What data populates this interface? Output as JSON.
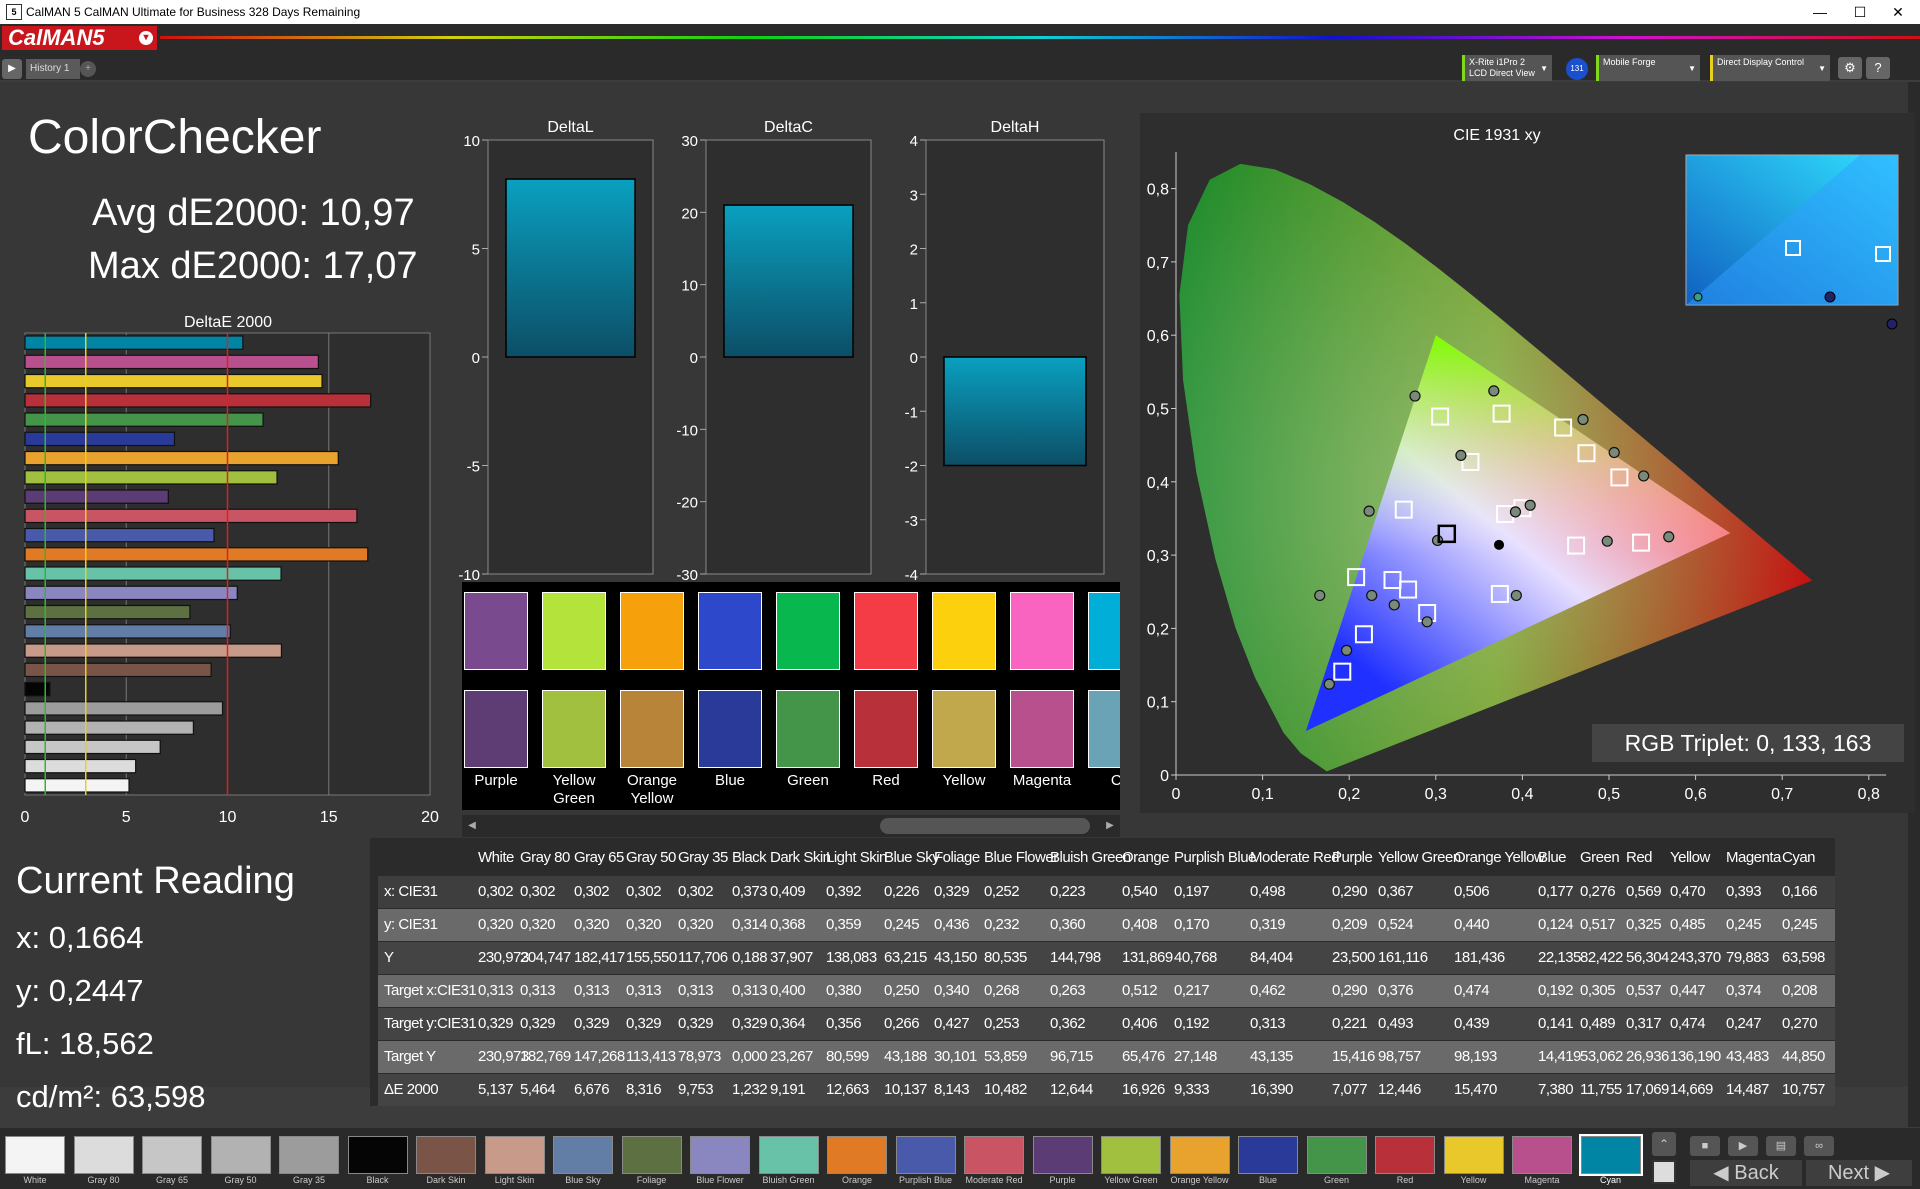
{
  "window": {
    "title": "CalMAN 5 CalMAN Ultimate for Business 328 Days Remaining",
    "minimize": "—",
    "maximize": "☐",
    "close": "✕"
  },
  "app": {
    "logo": "CalMAN5",
    "logo_dd": "▾",
    "history_tab": "History 1",
    "history_add": "+",
    "play": "▶"
  },
  "devices": [
    {
      "line1": "X-Rite i1Pro 2",
      "line2": "LCD Direct View",
      "badge": "131"
    },
    {
      "line1": "Mobile Forge",
      "line2": ""
    },
    {
      "line1": "Direct Display Control",
      "line2": ""
    }
  ],
  "toolbar_icons": [
    "gear-icon",
    "help-icon"
  ],
  "toolbar_glyphs": {
    "gear": "⚙",
    "help": "?"
  },
  "page": {
    "title": "ColorChecker",
    "avg": "Avg dE2000: 10,97",
    "max": "Max dE2000: 17,07"
  },
  "current_reading": {
    "title": "Current Reading",
    "x": "x: 0,1664",
    "y": "y: 0,2447",
    "fl": "fL: 18,562",
    "cdm2": "cd/m²: 63,598"
  },
  "rgb_triplet": "RGB Triplet: 0, 133, 163",
  "colors": {
    "White": "#f4f4f4",
    "Gray 80": "#dcdcdc",
    "Gray 65": "#c6c6c6",
    "Gray 50": "#b2b2b2",
    "Gray 35": "#9c9c9c",
    "Black": "#050505",
    "Dark Skin": "#7a5446",
    "Light Skin": "#c79a8a",
    "Blue Sky": "#627ea6",
    "Foliage": "#5c7042",
    "Blue Flower": "#8a86c0",
    "Bluish Green": "#68c2a8",
    "Orange": "#e07a24",
    "Purplish Blue": "#4a5aaa",
    "Moderate Red": "#c85464",
    "Purple": "#5c3c74",
    "Yellow Green": "#a2c040",
    "Orange Yellow": "#e8a22e",
    "Blue": "#2a3a98",
    "Green": "#44944a",
    "Red": "#b8303a",
    "Yellow": "#e8c82a",
    "Magenta": "#b8508e",
    "Cyan": "#0086a4"
  },
  "chart_data": [
    {
      "type": "bar",
      "title": "DeltaE 2000",
      "orientation": "horizontal",
      "categories": [
        "Cyan",
        "Magenta",
        "Yellow",
        "Red",
        "Green",
        "Blue",
        "Orange Yellow",
        "Yellow Green",
        "Purple",
        "Moderate Red",
        "Purplish Blue",
        "Orange",
        "Bluish Green",
        "Blue Flower",
        "Foliage",
        "Blue Sky",
        "Light Skin",
        "Dark Skin",
        "Black",
        "Gray 35",
        "Gray 50",
        "Gray 65",
        "Gray 80",
        "White"
      ],
      "values": [
        10.757,
        14.487,
        14.669,
        17.069,
        11.755,
        7.38,
        15.47,
        12.446,
        7.077,
        16.39,
        9.333,
        16.926,
        12.644,
        10.482,
        8.143,
        10.137,
        12.663,
        9.191,
        1.232,
        9.753,
        8.316,
        6.676,
        5.464,
        5.137
      ],
      "xlim": [
        0,
        20
      ],
      "xticks": [
        0,
        5,
        10,
        15,
        20
      ],
      "reference_lines": [
        1,
        3,
        10
      ]
    },
    {
      "type": "bar",
      "title": "DeltaL",
      "values": [
        8.2
      ],
      "ylim": [
        -10,
        10
      ],
      "yticks": [
        10,
        5,
        0,
        -5,
        -10
      ]
    },
    {
      "type": "bar",
      "title": "DeltaC",
      "values": [
        21.0
      ],
      "ylim": [
        -30,
        30
      ],
      "yticks": [
        30,
        20,
        10,
        0,
        -10,
        -20,
        -30
      ]
    },
    {
      "type": "bar",
      "title": "DeltaH",
      "values": [
        -2.0
      ],
      "ylim": [
        -4,
        4
      ],
      "yticks": [
        4,
        3,
        2,
        1,
        0,
        -1,
        -2,
        -3,
        -4
      ]
    },
    {
      "type": "scatter",
      "title": "CIE 1931 xy",
      "xlim": [
        0,
        0.8
      ],
      "ylim": [
        0,
        0.85
      ],
      "xticks": [
        "0",
        "0,1",
        "0,2",
        "0,3",
        "0,4",
        "0,5",
        "0,6",
        "0,7",
        "0,8"
      ],
      "yticks": [
        "0",
        "0,1",
        "0,2",
        "0,3",
        "0,4",
        "0,5",
        "0,6",
        "0,7",
        "0,8"
      ],
      "gamut": [
        [
          0.64,
          0.33
        ],
        [
          0.3,
          0.6
        ],
        [
          0.15,
          0.06
        ]
      ],
      "targets": [
        [
          0.313,
          0.329
        ],
        [
          0.4,
          0.364
        ],
        [
          0.38,
          0.356
        ],
        [
          0.25,
          0.266
        ],
        [
          0.34,
          0.427
        ],
        [
          0.268,
          0.253
        ],
        [
          0.263,
          0.362
        ],
        [
          0.512,
          0.406
        ],
        [
          0.217,
          0.192
        ],
        [
          0.462,
          0.313
        ],
        [
          0.29,
          0.221
        ],
        [
          0.376,
          0.493
        ],
        [
          0.474,
          0.439
        ],
        [
          0.192,
          0.141
        ],
        [
          0.305,
          0.489
        ],
        [
          0.537,
          0.317
        ],
        [
          0.447,
          0.474
        ],
        [
          0.374,
          0.247
        ],
        [
          0.208,
          0.27
        ]
      ],
      "measured": [
        [
          0.302,
          0.32
        ],
        [
          0.409,
          0.368
        ],
        [
          0.392,
          0.359
        ],
        [
          0.226,
          0.245
        ],
        [
          0.329,
          0.436
        ],
        [
          0.252,
          0.232
        ],
        [
          0.223,
          0.36
        ],
        [
          0.54,
          0.408
        ],
        [
          0.197,
          0.17
        ],
        [
          0.498,
          0.319
        ],
        [
          0.29,
          0.209
        ],
        [
          0.367,
          0.524
        ],
        [
          0.506,
          0.44
        ],
        [
          0.177,
          0.124
        ],
        [
          0.276,
          0.517
        ],
        [
          0.569,
          0.325
        ],
        [
          0.47,
          0.485
        ],
        [
          0.393,
          0.245
        ],
        [
          0.166,
          0.245
        ]
      ],
      "white_point": [
        0.3127,
        0.329
      ]
    }
  ],
  "swatches": {
    "top": [
      "#7a4a8e",
      "#b4e43c",
      "#f6a00c",
      "#2e48cc",
      "#08b84e",
      "#f43c46",
      "#fcd00c",
      "#f864c0",
      "#00aed8"
    ],
    "bottom": [
      "#5e3c74",
      "#a2c040",
      "#b8843a",
      "#2a3a98",
      "#44944a",
      "#b8303a",
      "#c2a84c",
      "#b8508e",
      "#6aa2b6"
    ],
    "labels": [
      "Purple",
      "Yellow\nGreen",
      "Orange\nYellow",
      "Blue",
      "Green",
      "Red",
      "Yellow",
      "Magenta",
      "Cy"
    ]
  },
  "table": {
    "columns": [
      "White",
      "Gray 80",
      "Gray 65",
      "Gray 50",
      "Gray 35",
      "Black",
      "Dark Skin",
      "Light Skin",
      "Blue Sky",
      "Foliage",
      "Blue Flower",
      "Bluish Green",
      "Orange",
      "Purplish Blue",
      "Moderate Red",
      "Purple",
      "Yellow Green",
      "Orange Yellow",
      "Blue",
      "Green",
      "Red",
      "Yellow",
      "Magenta",
      "Cyan"
    ],
    "rows": [
      {
        "label": "x: CIE31",
        "values": [
          "0,302",
          "0,302",
          "0,302",
          "0,302",
          "0,302",
          "0,373",
          "0,409",
          "0,392",
          "0,226",
          "0,329",
          "0,252",
          "0,223",
          "0,540",
          "0,197",
          "0,498",
          "0,290",
          "0,367",
          "0,506",
          "0,177",
          "0,276",
          "0,569",
          "0,470",
          "0,393",
          "0,166"
        ]
      },
      {
        "label": "y: CIE31",
        "values": [
          "0,320",
          "0,320",
          "0,320",
          "0,320",
          "0,320",
          "0,314",
          "0,368",
          "0,359",
          "0,245",
          "0,436",
          "0,232",
          "0,360",
          "0,408",
          "0,170",
          "0,319",
          "0,209",
          "0,524",
          "0,440",
          "0,124",
          "0,517",
          "0,325",
          "0,485",
          "0,245",
          "0,245"
        ]
      },
      {
        "label": "Y",
        "values": [
          "230,973",
          "204,747",
          "182,417",
          "155,550",
          "117,706",
          "0,188",
          "37,907",
          "138,083",
          "63,215",
          "43,150",
          "80,535",
          "144,798",
          "131,869",
          "40,768",
          "84,404",
          "23,500",
          "161,116",
          "181,436",
          "22,135",
          "82,422",
          "56,304",
          "243,370",
          "79,883",
          "63,598"
        ]
      },
      {
        "label": "Target x:CIE31",
        "values": [
          "0,313",
          "0,313",
          "0,313",
          "0,313",
          "0,313",
          "0,313",
          "0,400",
          "0,380",
          "0,250",
          "0,340",
          "0,268",
          "0,263",
          "0,512",
          "0,217",
          "0,462",
          "0,290",
          "0,376",
          "0,474",
          "0,192",
          "0,305",
          "0,537",
          "0,447",
          "0,374",
          "0,208"
        ]
      },
      {
        "label": "Target y:CIE31",
        "values": [
          "0,329",
          "0,329",
          "0,329",
          "0,329",
          "0,329",
          "0,329",
          "0,364",
          "0,356",
          "0,266",
          "0,427",
          "0,253",
          "0,362",
          "0,406",
          "0,192",
          "0,313",
          "0,221",
          "0,493",
          "0,439",
          "0,141",
          "0,489",
          "0,317",
          "0,474",
          "0,247",
          "0,270"
        ]
      },
      {
        "label": "Target Y",
        "values": [
          "230,973",
          "182,769",
          "147,268",
          "113,413",
          "78,973",
          "0,000",
          "23,267",
          "80,599",
          "43,188",
          "30,101",
          "53,859",
          "96,715",
          "65,476",
          "27,148",
          "43,135",
          "15,416",
          "98,757",
          "98,193",
          "14,419",
          "53,062",
          "26,936",
          "136,190",
          "43,483",
          "44,850"
        ]
      },
      {
        "label": "ΔE 2000",
        "values": [
          "5,137",
          "5,464",
          "6,676",
          "8,316",
          "9,753",
          "1,232",
          "9,191",
          "12,663",
          "10,137",
          "8,143",
          "10,482",
          "12,644",
          "16,926",
          "9,333",
          "16,390",
          "7,077",
          "12,446",
          "15,470",
          "7,380",
          "11,755",
          "17,069",
          "14,669",
          "14,487",
          "10,757"
        ]
      }
    ]
  },
  "patch_bar": {
    "labels": [
      "White",
      "Gray 80",
      "Gray 65",
      "Gray 50",
      "Gray 35",
      "Black",
      "Dark Skin",
      "Light Skin",
      "Blue Sky",
      "Foliage",
      "Blue Flower",
      "Bluish Green",
      "Orange",
      "Purplish Blue",
      "Moderate Red",
      "Purple",
      "Yellow Green",
      "Orange Yellow",
      "Blue",
      "Green",
      "Red",
      "Yellow",
      "Magenta",
      "Cyan"
    ],
    "selected": "Cyan"
  },
  "nav": {
    "back": "Back",
    "next": "Next",
    "back_arrow": "◀",
    "next_arrow": "▶"
  },
  "controls": [
    "stop-icon",
    "play-icon",
    "save-icon",
    "loop-icon"
  ],
  "control_glyphs": {
    "stop": "■",
    "play": "▶",
    "save": "▤",
    "loop": "∞",
    "expand": "⌃"
  }
}
